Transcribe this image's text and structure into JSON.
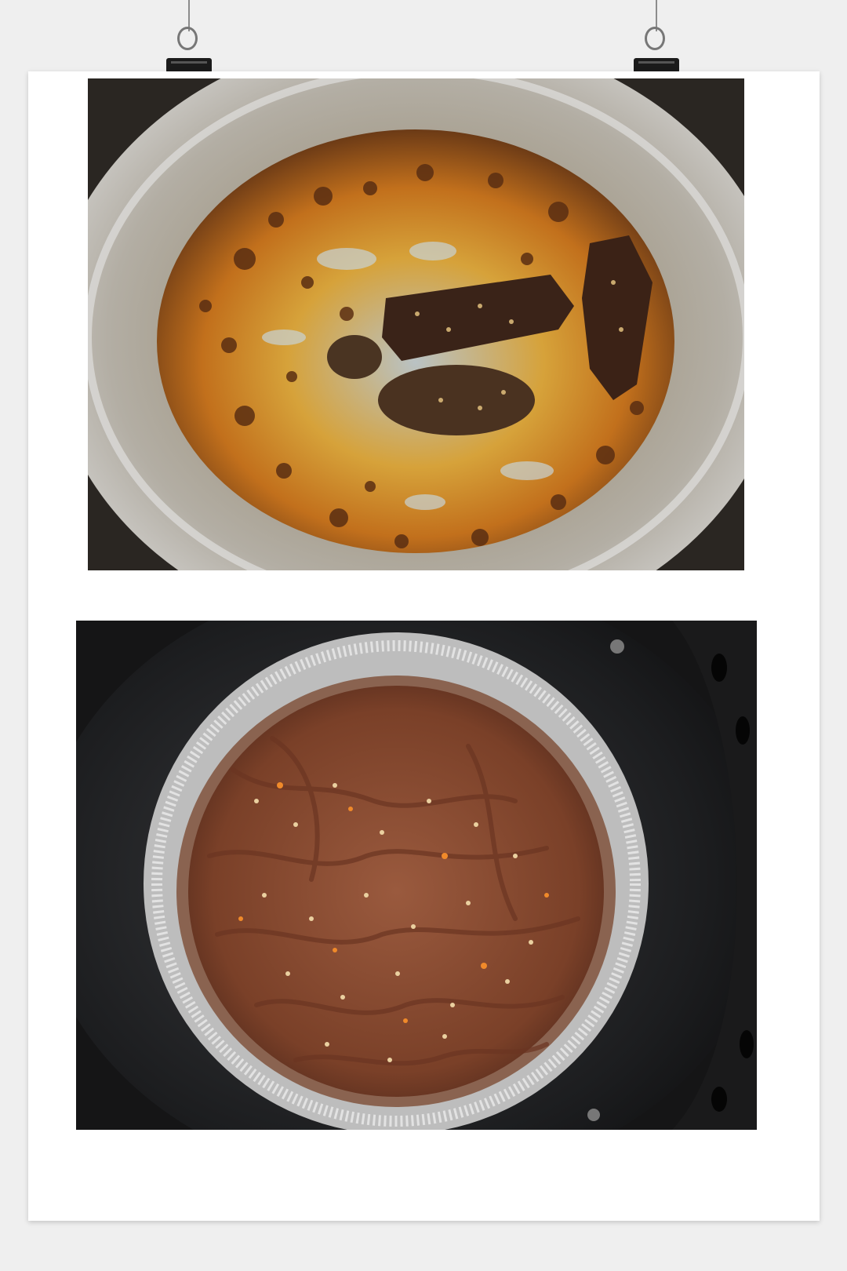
{
  "scene": {
    "background_color": "#efefef",
    "poster_color": "#ffffff",
    "clips": [
      "binder-clip-left",
      "binder-clip-right"
    ]
  },
  "photos": [
    {
      "id": "top",
      "subject_icon": "foil-pan-with-cooked-jerky-icon",
      "colors": {
        "foil": "#b9b7b2",
        "residue": "#c58a1e",
        "char": "#4a2a14",
        "meat": "#3b2418"
      }
    },
    {
      "id": "bottom",
      "subject_icon": "air-fryer-basket-with-marinated-beef-icon",
      "colors": {
        "basket": "#1f2022",
        "foil": "#c9c9c9",
        "meat": "#8a4a33",
        "seeds": "#e9c98a"
      }
    }
  ]
}
